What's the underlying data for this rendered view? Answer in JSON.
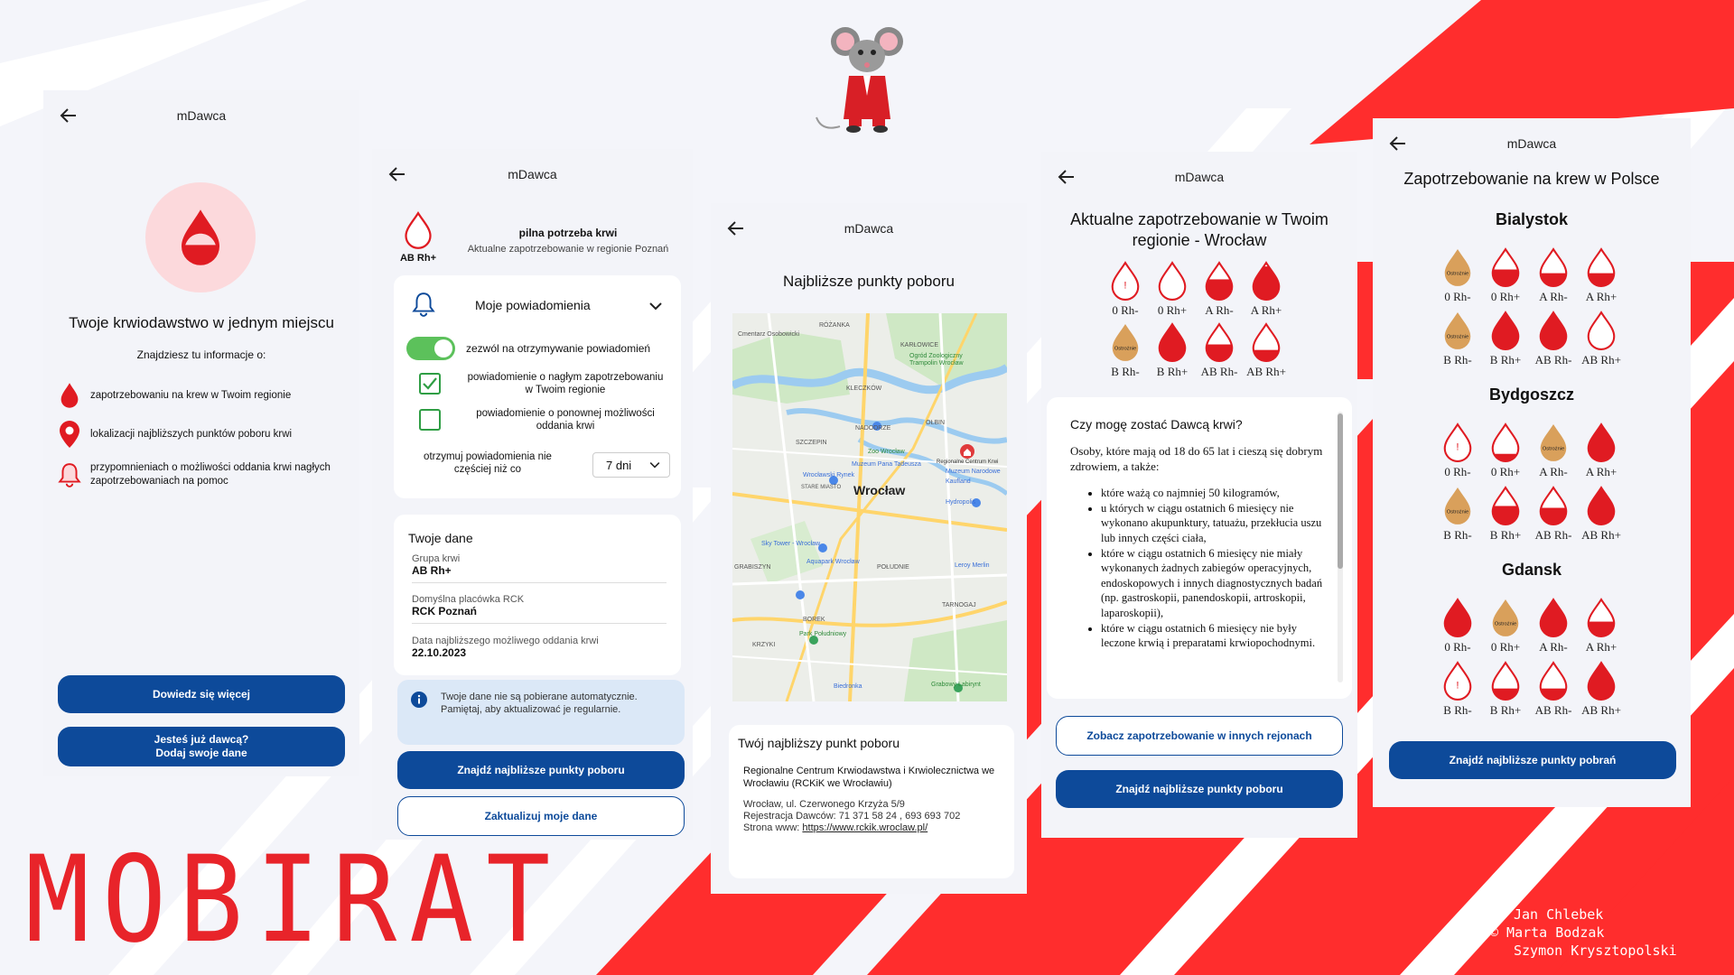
{
  "app_name": "mDawca",
  "colors": {
    "blood": "#e01b22",
    "primary": "#0d4a9a",
    "brand_red": "#ff2d2d",
    "caution": "#d9a05b",
    "toggle_green": "#5cc15b"
  },
  "branding": {
    "logo": "MOBIRAT",
    "credits": [
      "Jan Chlebek",
      "© Marta Bodzak",
      "Szymon Krysztopolski"
    ],
    "mascot": "rat-in-red-suit"
  },
  "s1": {
    "heading": "Twoje krwiodawstwo w jednym miejscu",
    "intro": "Znajdziesz tu informacje o:",
    "features": [
      {
        "icon": "blood-drop-icon",
        "text": "zapotrzebowaniu na krew w Twoim regionie"
      },
      {
        "icon": "location-pin-icon",
        "text": "lokalizacji najbliższych punktów poboru krwi"
      },
      {
        "icon": "bell-icon",
        "text": "przypomnieniach o możliwości oddania krwi nagłych zapotrzebowaniach na pomoc"
      }
    ],
    "btn_more": "Dowiedz się więcej",
    "btn_add_line1": "Jesteś już dawcą?",
    "btn_add_line2": "Dodaj swoje dane"
  },
  "s2": {
    "blood_type": "AB Rh+",
    "alert_title": "pilna potrzeba krwi",
    "alert_sub": "Aktualne zapotrzebowanie w regionie Poznań",
    "notif_title": "Moje powiadomienia",
    "allow_label": "zezwól na otrzymywanie powiadomień",
    "allow_on": true,
    "opt1": "powiadomienie o nagłym zapotrzebowaniu w Twoim regionie",
    "opt1_checked": true,
    "opt2": "powiadomienie o ponownej możliwości oddania krwi",
    "opt2_checked": false,
    "freq_label": "otrzymuj powiadomienia nie częściej niż co",
    "freq_value": "7 dni",
    "data_title": "Twoje dane",
    "fields": [
      {
        "label": "Grupa krwi",
        "value": "AB Rh+"
      },
      {
        "label": "Domyślna placówka RCK",
        "value": "RCK Poznań"
      },
      {
        "label": "Data najbliższego możliwego oddania krwi",
        "value": "22.10.2023"
      }
    ],
    "info": "Twoje dane nie są pobierane automatycznie. Pamiętaj, aby aktualizować je regularnie.",
    "btn_find": "Znajdź najbliższe punkty poboru",
    "btn_update": "Zaktualizuj moje dane"
  },
  "s3": {
    "heading": "Najbliższe punkty poboru",
    "map": {
      "city": "Wrocław",
      "places": [
        "Cmentarz Osobowicki",
        "RÓŻANKA",
        "KARŁOWICE",
        "Ogród Zoologiczny",
        "Trampolin Wrocław",
        "KLECZKÓW",
        "NADODRZE",
        "OŁBIN",
        "SZCZEPIN",
        "Zoo Wrocław",
        "Regionalne Centrum Krwi",
        "Muzeum Narodowe",
        "Kaufland",
        "Wrocławski Rynek",
        "STARE MIASTO",
        "Hydropolis",
        "Muzeum Pana Tadeusza",
        "Sky Tower - Wrocław",
        "Wrocław",
        "Aquapark Wrocław",
        "POŁUDNIE",
        "Leroy Merlin",
        "GRABISZYN",
        "BOREK",
        "TARNOGAJ",
        "KRZYKI",
        "Park Południowy",
        "Biedronka",
        "Grabowy Labirynt"
      ]
    },
    "nearest_title": "Twój najbliższy punkt poboru",
    "nearest_name": "Regionalne Centrum Krwiodawstwa i Krwiolecznictwa we Wrocławiu (RCKiK we Wrocławiu)",
    "address": "Wrocław, ul. Czerwonego Krzyża 5/9",
    "phone": "Rejestracja Dawców: 71 371 58 24 , 693 693 702",
    "web_label": "Strona www: ",
    "web_url": "https://www.rckik.wroclaw.pl/"
  },
  "s4": {
    "heading": "Aktualne zapotrzebowanie w Twoim regionie - Wrocław",
    "levels": [
      {
        "type": "0 Rh-",
        "level": 0.0,
        "alert": true
      },
      {
        "type": "0 Rh+",
        "level": 0.0
      },
      {
        "type": "A Rh-",
        "level": 0.55
      },
      {
        "type": "A Rh+",
        "level": 0.9
      },
      {
        "type": "B Rh-",
        "caution": "Ostrożnie"
      },
      {
        "type": "B Rh+",
        "level": 0.95
      },
      {
        "type": "AB Rh-",
        "level": 0.45
      },
      {
        "type": "AB Rh+",
        "level": 0.3
      }
    ],
    "faq_title": "Czy mogę zostać Dawcą krwi?",
    "faq_intro": "Osoby, które mają od 18 do 65 lat i cieszą się dobrym zdrowiem, a także:",
    "faq_items": [
      "które ważą co najmniej 50 kilogramów,",
      "u których w ciągu ostatnich 6 miesięcy nie wykonano akupunktury, tatuażu, przekłucia uszu lub innych części ciała,",
      "które w ciągu ostatnich 6 miesięcy nie miały wykonanych żadnych zabiegów operacyjnych, endoskopowych i innych diagnostycznych badań (np. gastroskopii, panendoskopii, artroskopii, laparoskopii),",
      "które w ciągu ostatnich 6 miesięcy nie były leczone krwią i preparatami krwiopochodnymi."
    ],
    "btn_other": "Zobacz zapotrzebowanie w innych rejonach",
    "btn_find": "Znajdź najbliższe punkty poboru"
  },
  "s5": {
    "heading": "Zapotrzebowanie na krew w Polsce",
    "cities": [
      {
        "name": "Bialystok",
        "levels": [
          {
            "type": "0 Rh-",
            "caution": "Ostrożnie"
          },
          {
            "type": "0 Rh+",
            "level": 0.45
          },
          {
            "type": "A Rh-",
            "level": 0.35
          },
          {
            "type": "A Rh+",
            "level": 0.35
          },
          {
            "type": "B Rh-",
            "caution": "Ostrożnie"
          },
          {
            "type": "B Rh+",
            "level": 0.95
          },
          {
            "type": "AB Rh-",
            "level": 0.95
          },
          {
            "type": "AB Rh+",
            "level": 0.0
          }
        ]
      },
      {
        "name": "Bydgoszcz",
        "levels": [
          {
            "type": "0 Rh-",
            "level": 0.0,
            "alert": true
          },
          {
            "type": "0 Rh+",
            "level": 0.2
          },
          {
            "type": "A Rh-",
            "caution": "Ostrożnie"
          },
          {
            "type": "A Rh+",
            "level": 0.95
          },
          {
            "type": "B Rh-",
            "caution": "Ostrożnie"
          },
          {
            "type": "B Rh+",
            "level": 0.5
          },
          {
            "type": "AB Rh-",
            "level": 0.45
          },
          {
            "type": "AB Rh+",
            "level": 0.95
          }
        ]
      },
      {
        "name": "Gdansk",
        "levels": [
          {
            "type": "0 Rh-",
            "level": 0.95
          },
          {
            "type": "0 Rh+",
            "caution": "Ostrożnie"
          },
          {
            "type": "A Rh-",
            "level": 0.95
          },
          {
            "type": "A Rh+",
            "level": 0.4
          },
          {
            "type": "B Rh-",
            "level": 0.0,
            "alert": true
          },
          {
            "type": "B Rh+",
            "level": 0.3
          },
          {
            "type": "AB Rh-",
            "level": 0.3
          },
          {
            "type": "AB Rh+",
            "level": 0.95
          }
        ]
      }
    ],
    "btn_find": "Znajdź najbliższe punkty pobrań"
  }
}
